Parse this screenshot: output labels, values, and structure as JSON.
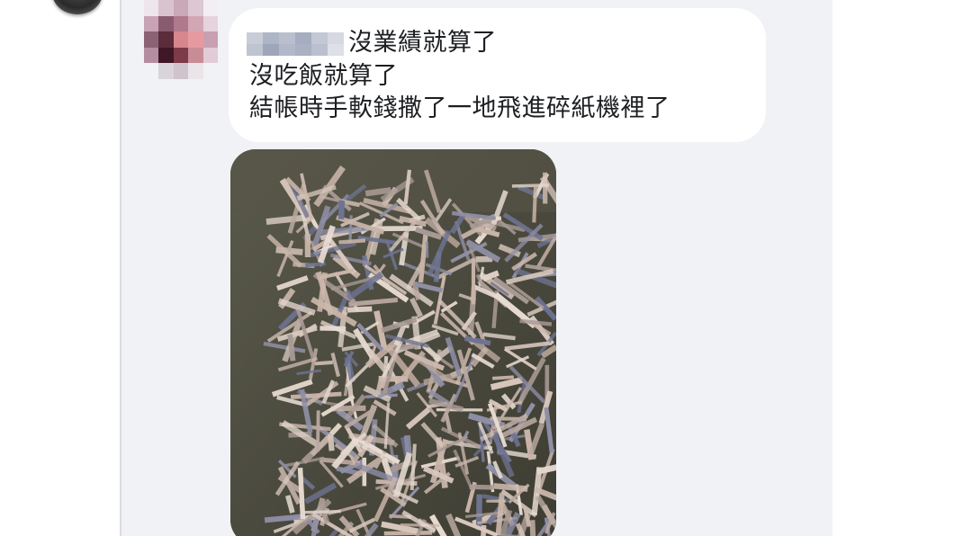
{
  "comment": {
    "lines": [
      "沒業績就算了",
      "沒吃飯就算了",
      "結帳時手軟錢撒了一地飛進碎紙機裡了"
    ]
  },
  "photo": {
    "subject": "shredded-paper-money-photo"
  },
  "colors": {
    "feed_background": "#f0f2f5",
    "bubble_background": "#ffffff",
    "text": "#1c1e21",
    "page_background": "#ffffff"
  }
}
